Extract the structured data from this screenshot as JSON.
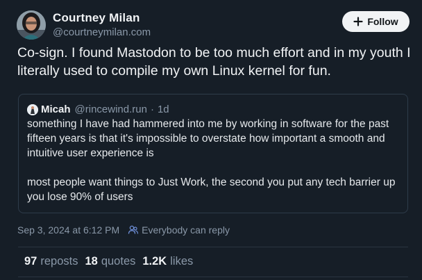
{
  "author": {
    "name": "Courtney Milan",
    "handle": "@courtneymilan.com",
    "avatar_icon": "author-avatar"
  },
  "follow_button": {
    "label": "Follow",
    "icon": "plus-icon"
  },
  "post": {
    "text": "Co-sign. I found Mastodon to be too much effort and in my youth I literally used to compile my own Linux kernel for fun."
  },
  "quote": {
    "author_name": "Micah",
    "handle": "@rincewind.run",
    "separator": "·",
    "time": "1d",
    "paragraphs": [
      "something I have had hammered into me by working in software for the past fifteen years is that it's impossible to overstate how important a smooth and intuitive user experience is",
      "most people want things to Just Work, the second you put any tech barrier up you lose 90% of users"
    ]
  },
  "meta": {
    "date": "Sep 3, 2024",
    "at": "at",
    "time": "6:12 PM",
    "reply_setting": "Everybody can reply",
    "reply_icon": "people-icon"
  },
  "stats": {
    "reposts_count": "97",
    "reposts_label": "reposts",
    "quotes_count": "18",
    "quotes_label": "quotes",
    "likes_count": "1.2K",
    "likes_label": "likes"
  },
  "colors": {
    "background": "#161e27",
    "text_primary": "#f1f3f5",
    "text_secondary": "#8a98a8",
    "border": "#2e3c4a",
    "follow_button_bg": "#f1f3f5"
  }
}
